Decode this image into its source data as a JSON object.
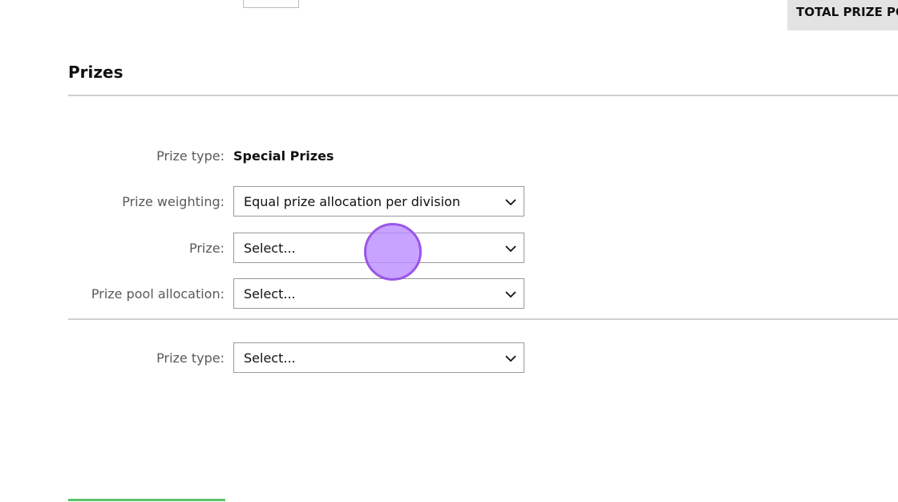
{
  "header": {
    "total_prize_label": "TOTAL PRIZE PO"
  },
  "section": {
    "title": "Prizes"
  },
  "prize_group": {
    "prize_type_label": "Prize type:",
    "prize_type_value": "Special Prizes",
    "weighting_label": "Prize weighting:",
    "weighting_value": "Equal prize allocation per division",
    "prize_label": "Prize:",
    "prize_value": "Select...",
    "pool_label": "Prize pool allocation:",
    "pool_value": "Select..."
  },
  "new_prize": {
    "prize_type_label": "Prize type:",
    "prize_type_value": "Select..."
  },
  "colors": {
    "accent_green": "#5cc36a",
    "cursor_purple": "#9a56e8",
    "banner_grey": "#e3e3e3"
  },
  "icons": {
    "dropdown": "chevron-down-icon"
  }
}
